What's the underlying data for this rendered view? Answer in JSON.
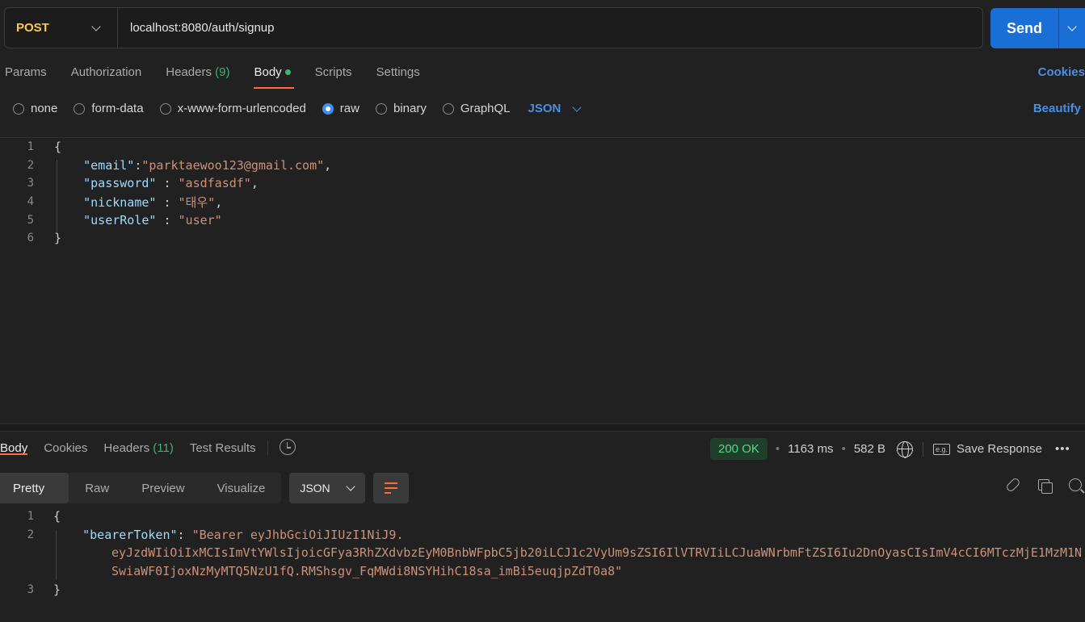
{
  "request": {
    "method": "POST",
    "url": "localhost:8080/auth/signup",
    "send_label": "Send",
    "tabs": [
      {
        "label": "Params",
        "count": ""
      },
      {
        "label": "Authorization",
        "count": ""
      },
      {
        "label": "Headers",
        "count": "(9)"
      },
      {
        "label": "Body",
        "count": ""
      },
      {
        "label": "Scripts",
        "count": ""
      },
      {
        "label": "Settings",
        "count": ""
      }
    ],
    "cookies_label": "Cookies",
    "body_types": [
      "none",
      "form-data",
      "x-www-form-urlencoded",
      "raw",
      "binary",
      "GraphQL"
    ],
    "selected_body_type": "raw",
    "format": "JSON",
    "beautify_label": "Beautify",
    "body_lines": {
      "l1": "{",
      "email_key": "\"email\"",
      "email_val": "\"parktaewoo123@gmail.com\"",
      "password_key": "\"password\"",
      "password_val": "\"asdfasdf\"",
      "nickname_key": "\"nickname\"",
      "nickname_val": "\"태우\"",
      "userrole_key": "\"userRole\"",
      "userrole_val": "\"user\"",
      "l6": "}"
    },
    "line_numbers": [
      "1",
      "2",
      "3",
      "4",
      "5",
      "6"
    ]
  },
  "response": {
    "tabs": [
      {
        "label": "Body",
        "count": ""
      },
      {
        "label": "Cookies",
        "count": ""
      },
      {
        "label": "Headers",
        "count": "(11)"
      },
      {
        "label": "Test Results",
        "count": ""
      }
    ],
    "status": "200 OK",
    "time": "1163 ms",
    "size": "582 B",
    "save_label": "Save Response",
    "eg_label": "e.g.",
    "more_label": "•••",
    "views": [
      "Pretty",
      "Raw",
      "Preview",
      "Visualize"
    ],
    "format": "JSON",
    "line_numbers": [
      "1",
      "2",
      "3"
    ],
    "body": {
      "l1": "{",
      "token_key": "\"bearerToken\"",
      "token_part1": "\"Bearer eyJhbGciOiJIUzI1NiJ9.",
      "token_part2": "eyJzdWIiOiIxMCIsImVtYWlsIjoicGFya3RhZXdvbzEyM0BnbWFpbC5jb20iLCJ1c2VyUm9sZSI6IlVTRVIiLCJuaWNrbmFtZSI6Iu2DnOyasCIsImV4cCI6MTczMjE1MzM1N",
      "token_part3": "SwiaWF0IjoxNzMyMTQ5NzU1fQ.RMShsgv_FqMWdi8NSYHihC18sa_imBi5euqjpZdT0a8\"",
      "l3": "}"
    }
  }
}
